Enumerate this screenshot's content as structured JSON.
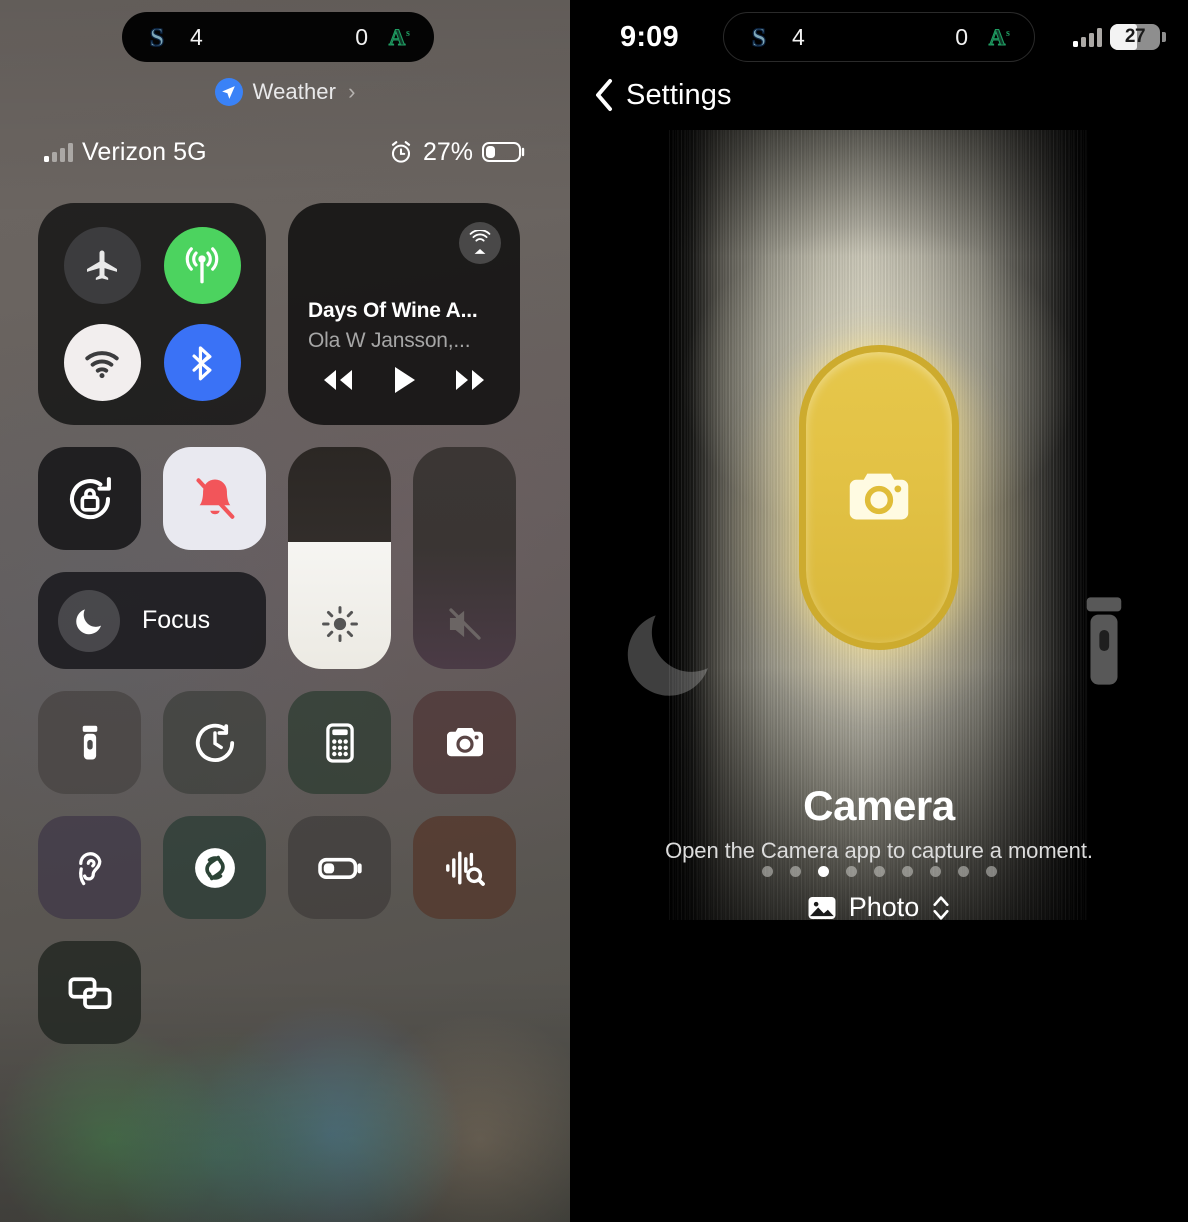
{
  "left_pane": {
    "name": "Control Center",
    "dynamic_island": {
      "activity": "baseball-live-score",
      "away_team_abbr": "SEA",
      "away_logo_name": "mariners-logo-icon",
      "away_score": "4",
      "home_score": "0",
      "home_team_abbr": "OAK",
      "home_logo_name": "athletics-logo-icon"
    },
    "weather_link": {
      "label": "Weather",
      "icon": "location-arrow-icon",
      "chevron": "›",
      "accent": "#3a82f7"
    },
    "status_bar": {
      "carrier": "Verizon 5G",
      "battery_percent": "27%",
      "alarm_icon": "alarm-clock-icon",
      "signal_icon": "cellular-bars-icon"
    },
    "connectivity": {
      "tiles": [
        {
          "name": "airplane-mode",
          "icon": "airplane-icon",
          "state": "off",
          "color": "#3c3c3e"
        },
        {
          "name": "cellular-data",
          "icon": "cellular-antenna-icon",
          "state": "on",
          "color": "#4cd35f"
        },
        {
          "name": "wifi",
          "icon": "wifi-icon",
          "state": "on",
          "color": "#f2eeee"
        },
        {
          "name": "bluetooth",
          "icon": "bluetooth-icon",
          "state": "on",
          "color": "#3a72f6"
        }
      ]
    },
    "media": {
      "title": "Days Of Wine A...",
      "artist": "Ola W Jansson,...",
      "airplay_icon": "airplay-audio-icon",
      "controls": [
        "rewind-button",
        "play-button",
        "fast-forward-button"
      ]
    },
    "toggles": {
      "rotation_lock": {
        "icon": "rotation-lock-icon",
        "state": "off"
      },
      "silent_mode": {
        "icon": "bell-slash-icon",
        "state": "on",
        "color": "#f2555a"
      },
      "focus": {
        "label": "Focus",
        "icon": "moon-icon",
        "state": "off"
      }
    },
    "sliders": {
      "brightness": {
        "icon": "sun-icon",
        "value_percent": 57
      },
      "volume": {
        "icon": "speaker-mute-icon",
        "value_percent": 0,
        "muted": true
      }
    },
    "app_tiles": [
      {
        "name": "flashlight",
        "icon": "flashlight-icon"
      },
      {
        "name": "timer",
        "icon": "timer-icon"
      },
      {
        "name": "calculator",
        "icon": "calculator-icon"
      },
      {
        "name": "camera",
        "icon": "camera-icon"
      },
      {
        "name": "hearing",
        "icon": "ear-icon"
      },
      {
        "name": "shazam",
        "icon": "shazam-icon"
      },
      {
        "name": "low-power-mode",
        "icon": "battery-icon"
      },
      {
        "name": "sound-recognition",
        "icon": "sound-recognition-icon"
      },
      {
        "name": "screen-mirroring",
        "icon": "screen-mirroring-icon"
      }
    ]
  },
  "right_pane": {
    "name": "Action Button settings",
    "status_bar": {
      "time": "9:09",
      "battery_percent": "27",
      "signal_icon": "cellular-bars-icon"
    },
    "dynamic_island": {
      "away_score": "4",
      "home_score": "0",
      "away_logo_name": "mariners-logo-icon",
      "home_logo_name": "athletics-logo-icon"
    },
    "back_button": {
      "label": "Settings",
      "icon": "chevron-left-icon"
    },
    "carousel": {
      "total_pages": 9,
      "active_index": 2,
      "previous_icon": "moon-icon",
      "next_icon": "flashlight-icon"
    },
    "action_button": {
      "icon": "camera-icon",
      "button_color": "#e3c245",
      "border_color": "#cdab2e"
    },
    "title": "Camera",
    "description": "Open the Camera app to capture a moment.",
    "option_picker": {
      "label": "Photo",
      "icon": "photo-icon",
      "stepper_icon": "chevron-up-down-icon"
    }
  }
}
